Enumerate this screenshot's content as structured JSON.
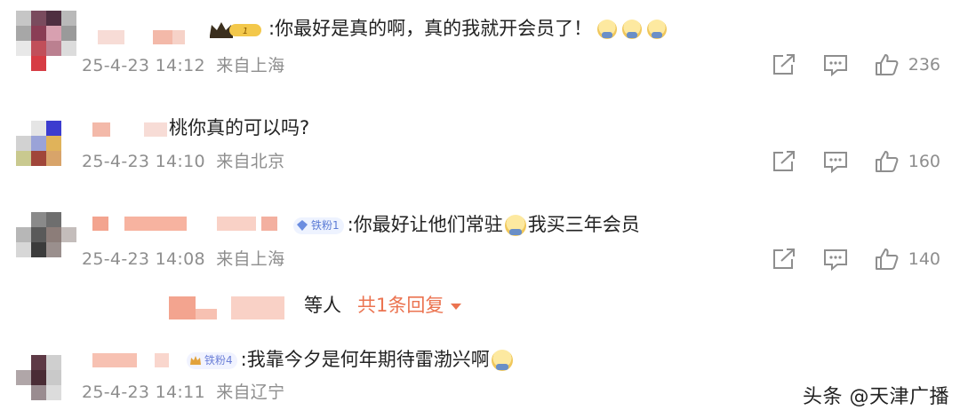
{
  "comments": [
    {
      "badge": "1",
      "text": ":你最好是真的啊，真的我就开会员了！",
      "emojis": [
        "grimace-emoji",
        "grimace-emoji",
        "grimace-emoji"
      ],
      "date": "25-4-23 14:12",
      "location": "来自上海",
      "likes": "236"
    },
    {
      "badge": "",
      "text": "桃你真的可以吗?",
      "date": "25-4-23 14:10",
      "location": "来自北京",
      "likes": "160"
    },
    {
      "badge": "铁粉1",
      "text": ":你最好让他们常驻",
      "text2": "我买三年会员",
      "date": "25-4-23 14:08",
      "location": "来自上海",
      "likes": "140",
      "reply_summary": {
        "suffix": "等人",
        "link": "共1条回复"
      }
    },
    {
      "badge": "铁粉4",
      "text": ":我靠今夕是何年期待雷渤兴啊",
      "date": "25-4-23 14:11",
      "location": "来自辽宁"
    }
  ],
  "watermark": "头条 @天津广播",
  "colors": {
    "meta": "#8e8e8e",
    "reply_link": "#eb7350",
    "badge_text": "#5b7bd5"
  }
}
